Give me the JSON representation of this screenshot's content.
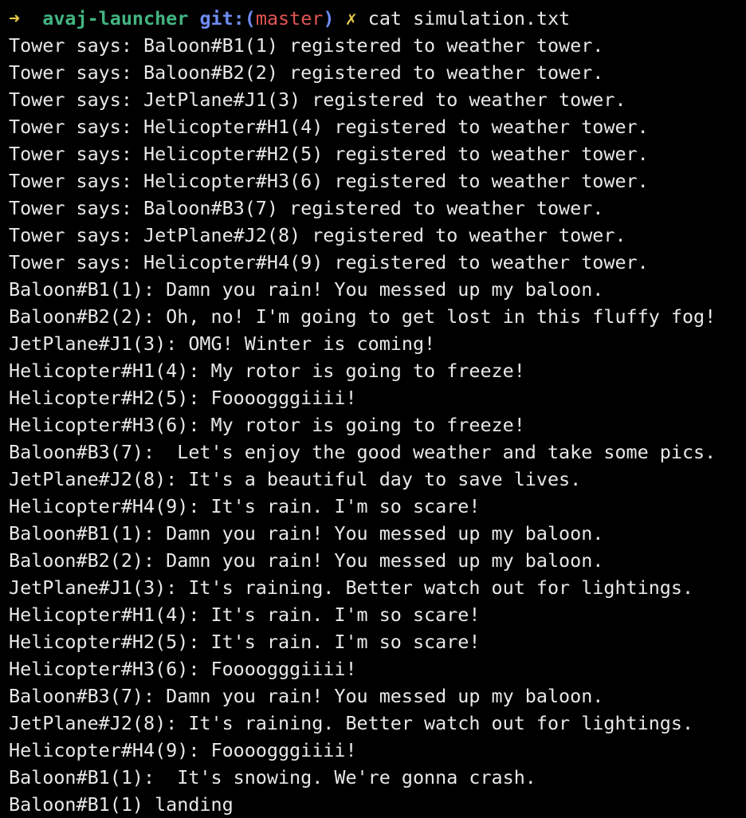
{
  "prompt": {
    "arrow": "➜",
    "directory": "avaj-launcher",
    "git_label": "git:",
    "paren_open": "(",
    "branch": "master",
    "paren_close": ")",
    "dirty_marker": "✗",
    "command": "cat simulation.txt"
  },
  "colors": {
    "background": "#000000",
    "text": "#e8e8e8",
    "arrow": "#e6c84a",
    "directory": "#43b581",
    "git_label": "#6f8cf5",
    "branch": "#e25555"
  },
  "output_lines": [
    "Tower says: Baloon#B1(1) registered to weather tower.",
    "Tower says: Baloon#B2(2) registered to weather tower.",
    "Tower says: JetPlane#J1(3) registered to weather tower.",
    "Tower says: Helicopter#H1(4) registered to weather tower.",
    "Tower says: Helicopter#H2(5) registered to weather tower.",
    "Tower says: Helicopter#H3(6) registered to weather tower.",
    "Tower says: Baloon#B3(7) registered to weather tower.",
    "Tower says: JetPlane#J2(8) registered to weather tower.",
    "Tower says: Helicopter#H4(9) registered to weather tower.",
    "Baloon#B1(1): Damn you rain! You messed up my baloon.",
    "Baloon#B2(2): Oh, no! I'm going to get lost in this fluffy fog!",
    "JetPlane#J1(3): OMG! Winter is coming!",
    "Helicopter#H1(4): My rotor is going to freeze!",
    "Helicopter#H2(5): Foooogggiiii!",
    "Helicopter#H3(6): My rotor is going to freeze!",
    "Baloon#B3(7):  Let's enjoy the good weather and take some pics.",
    "JetPlane#J2(8): It's a beautiful day to save lives.",
    "Helicopter#H4(9): It's rain. I'm so scare!",
    "Baloon#B1(1): Damn you rain! You messed up my baloon.",
    "Baloon#B2(2): Damn you rain! You messed up my baloon.",
    "JetPlane#J1(3): It's raining. Better watch out for lightings.",
    "Helicopter#H1(4): It's rain. I'm so scare!",
    "Helicopter#H2(5): It's rain. I'm so scare!",
    "Helicopter#H3(6): Foooogggiiii!",
    "Baloon#B3(7): Damn you rain! You messed up my baloon.",
    "JetPlane#J2(8): It's raining. Better watch out for lightings.",
    "Helicopter#H4(9): Foooogggiiii!",
    "Baloon#B1(1):  It's snowing. We're gonna crash.",
    "Baloon#B1(1) landing"
  ]
}
